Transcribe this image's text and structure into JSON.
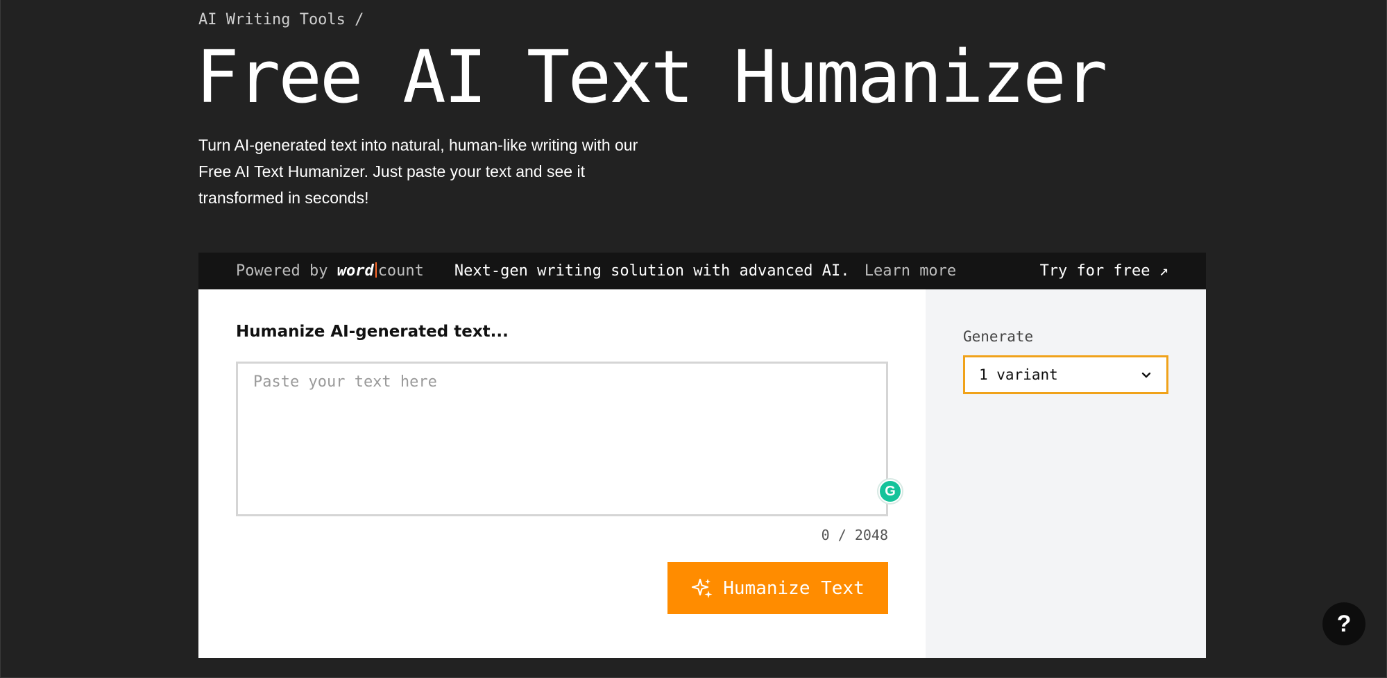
{
  "breadcrumb": {
    "label": "AI Writing Tools /"
  },
  "hero": {
    "title": "Free AI Text Humanizer",
    "description": "Turn AI-generated text into natural, human-like writing with our Free AI Text Humanizer. Just paste your text and see it transformed in seconds!"
  },
  "promo": {
    "powered_by": "Powered by",
    "brand_word": "word",
    "brand_count": "count",
    "tagline": "Next-gen writing solution with advanced AI.",
    "learn_more": "Learn more",
    "try_free": "Try for free ↗"
  },
  "form": {
    "label": "Humanize AI-generated text...",
    "placeholder": "Paste your text here",
    "value": "",
    "char_count": "0 / 2048",
    "submit_label": "Humanize Text",
    "submit_icon": "sparkles-icon",
    "extension_icon": "grammarly-icon"
  },
  "sidebar": {
    "generate_label": "Generate",
    "variant_selected": "1 variant"
  },
  "help": {
    "label": "?"
  },
  "colors": {
    "background": "#222222",
    "accent": "#ff8c00",
    "select_border": "#f0a21a",
    "panel": "#ffffff",
    "side_panel": "#f3f4f6"
  }
}
